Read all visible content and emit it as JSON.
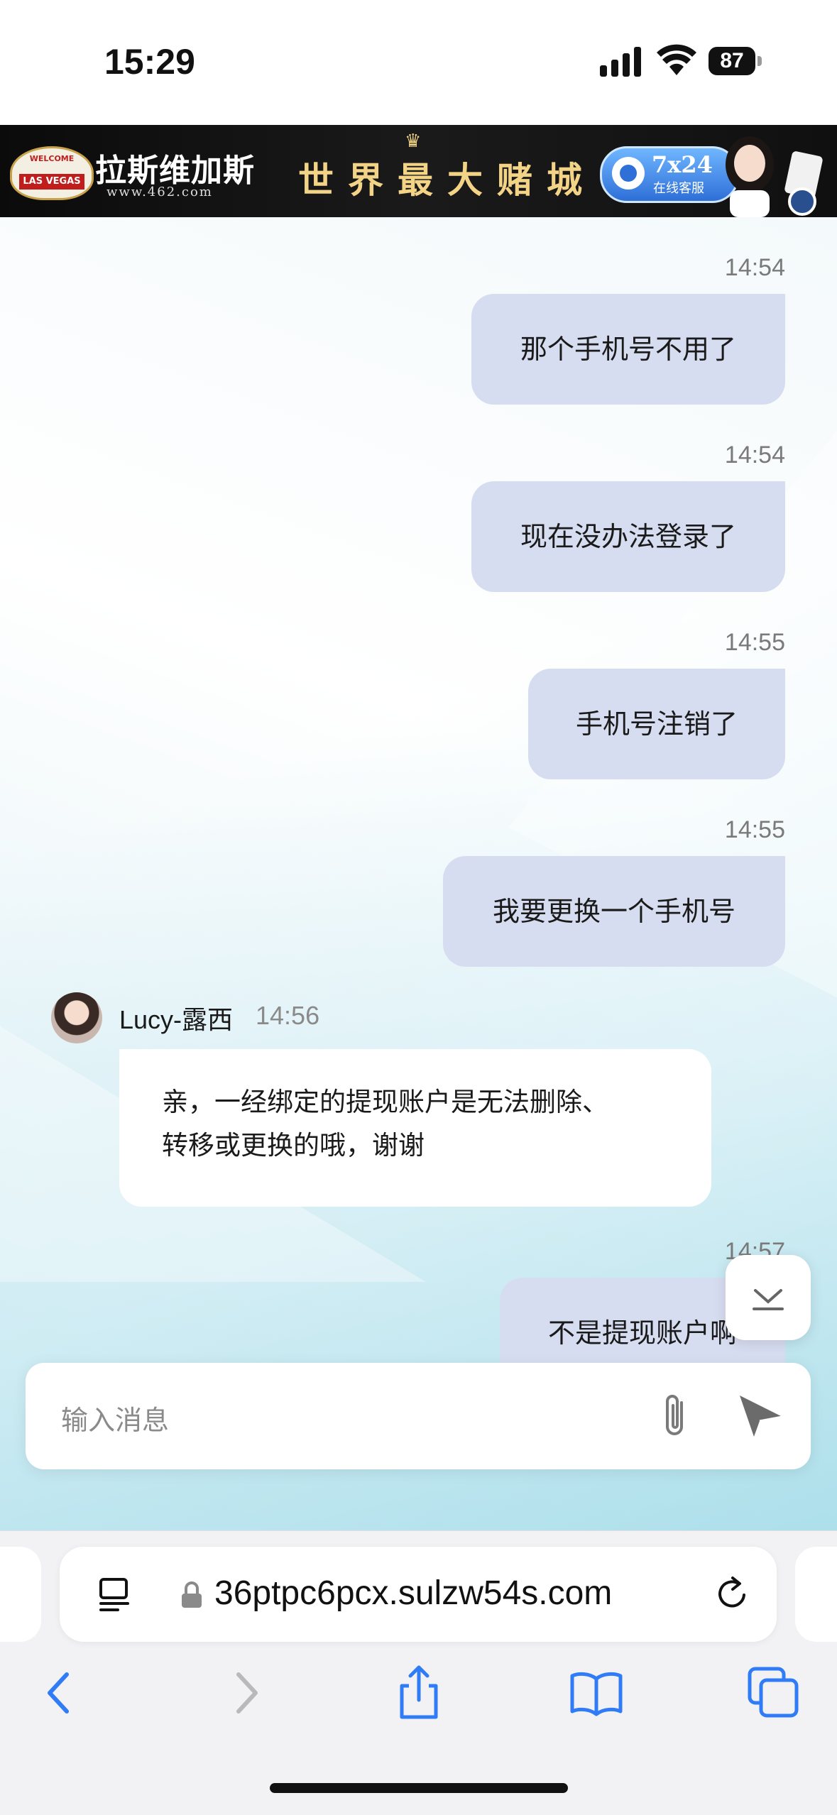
{
  "status_bar": {
    "time": "15:29",
    "battery": "87"
  },
  "banner": {
    "brand_name": "拉斯维加斯",
    "brand_url": "www.462.com",
    "sign_text": "LAS VEGAS",
    "slogan": "世界最大赌城",
    "support_badge_main": "7x24",
    "support_badge_sub": "在线客服"
  },
  "messages": [
    {
      "from": "me",
      "time": "14:54",
      "text": "那个手机号不用了"
    },
    {
      "from": "me",
      "time": "14:54",
      "text": "现在没办法登录了"
    },
    {
      "from": "me",
      "time": "14:55",
      "text": "手机号注销了"
    },
    {
      "from": "me",
      "time": "14:55",
      "text": "我要更换一个手机号"
    },
    {
      "from": "agent",
      "sender": "Lucy-露西",
      "time": "14:56",
      "line1": "亲，一经绑定的提现账户是无法删除、",
      "line2": "转移或更换的哦，谢谢"
    },
    {
      "from": "me",
      "time": "14:57",
      "text": "不是提现账户啊"
    }
  ],
  "composer": {
    "placeholder": "输入消息"
  },
  "browser": {
    "url": "36ptpc6pcx.sulzw54s.com"
  },
  "colors": {
    "my_bubble": "#d7ddf0",
    "agent_bubble": "#ffffff",
    "safari_blue": "#2f7cf6"
  }
}
